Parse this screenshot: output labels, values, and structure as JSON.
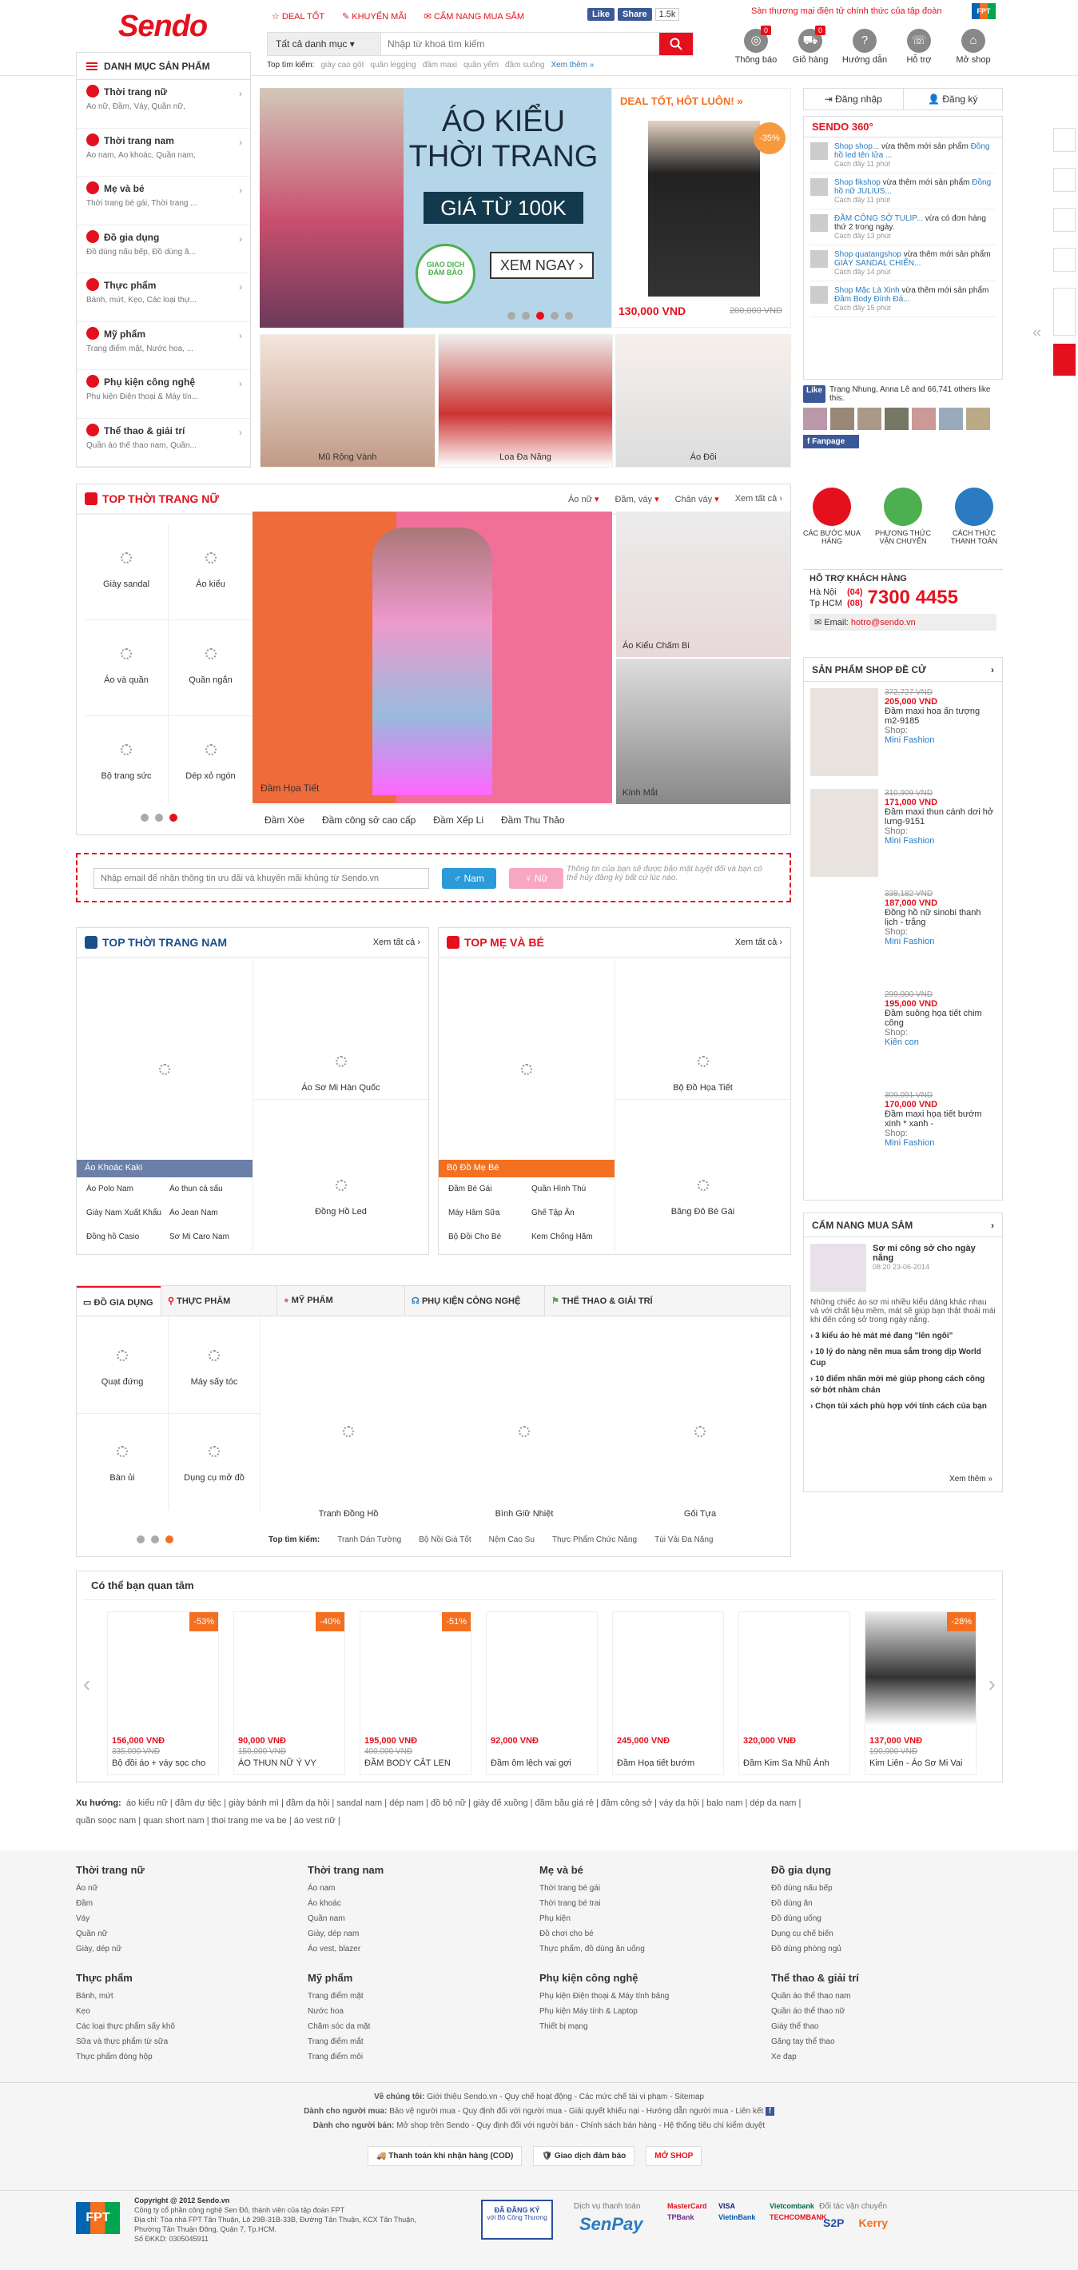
{
  "header": {
    "logo": "Sendo",
    "toplinks": [
      "DEAL TỐT",
      "KHUYẾN MÃI",
      "CẨM NANG MUA SẮM"
    ],
    "fb_like": "Like",
    "fb_share": "Share",
    "fb_count": "1.5k",
    "promo": "Sàn thương mại điện tử chính thức của tập đoàn",
    "fpt": "FPT",
    "search_category": "Tất cả danh mục",
    "search_placeholder": "Nhập từ khoá tìm kiếm",
    "top_search_label": "Top tìm kiếm:",
    "top_search": [
      "giày cao gót",
      "quần legging",
      "đầm maxi",
      "quần yếm",
      "đầm suông"
    ],
    "top_search_more": "Xem thêm »",
    "icons": [
      {
        "label": "Thông báo",
        "badge": "0",
        "icon": "globe-icon"
      },
      {
        "label": "Giỏ hàng",
        "badge": "0",
        "icon": "cart-icon"
      },
      {
        "label": "Hướng dẫn",
        "badge": "",
        "icon": "guide-icon"
      },
      {
        "label": "Hỗ trợ",
        "badge": "",
        "icon": "support-icon"
      },
      {
        "label": "Mở shop",
        "badge": "",
        "icon": "shop-icon"
      }
    ]
  },
  "sidebar": {
    "title": "DANH MỤC SẢN PHẨM",
    "items": [
      {
        "label": "Thời trang nữ",
        "sub": "Áo nữ, Đầm, Váy, Quần nữ,"
      },
      {
        "label": "Thời trang nam",
        "sub": "Áo nam, Áo khoác, Quần nam,"
      },
      {
        "label": "Mẹ và bé",
        "sub": "Thời trang bé gái, Thời trang ..."
      },
      {
        "label": "Đồ gia dụng",
        "sub": "Đồ dùng nấu bếp, Đồ dùng ă..."
      },
      {
        "label": "Thực phẩm",
        "sub": "Bánh, mứt, Kẹo, Các loại thự..."
      },
      {
        "label": "Mỹ phẩm",
        "sub": "Trang điểm mặt, Nước hoa, ..."
      },
      {
        "label": "Phụ kiện công nghệ",
        "sub": "Phụ kiện Điện thoại & Máy tín..."
      },
      {
        "label": "Thể thao & giải trí",
        "sub": "Quần áo thể thao nam, Quần..."
      }
    ]
  },
  "hero": {
    "title_line1": "ÁO KIỂU",
    "title_line2": "THỜI TRANG",
    "price": "GIÁ TỪ 100K",
    "cta": "XEM NGAY",
    "seal": "GIAO DỊCH ĐẢM BẢO",
    "active_slide": 4
  },
  "deal": {
    "title": "DEAL TỐT, HÔT LUÔN!",
    "discount": "-35%",
    "price": "130,000 VND",
    "old_price": "200,000 VND"
  },
  "thumbs": [
    "Mũ Rộng Vành",
    "Loa Đa Năng",
    "Áo Đôi"
  ],
  "account": {
    "login": "Đăng nhập",
    "register": "Đăng ký"
  },
  "sendo360": {
    "title": "SENDO 360°",
    "feed": [
      {
        "shop": "Shop shop...",
        "text": "vừa thêm mới sản phẩm",
        "product": "Đồng hồ led tên lửa ...",
        "time": "Cách đây 11 phút"
      },
      {
        "shop": "Shop fikshop",
        "text": "vừa thêm mới sản phẩm",
        "product": "Đồng hồ nữ JULIUS...",
        "time": "Cách đây 11 phút"
      },
      {
        "shop": "ĐẦM CÔNG SỞ TULIP...",
        "text": "vừa có đơn hàng thứ 2 trong ngày.",
        "product": "",
        "time": "Cách đây 13 phút"
      },
      {
        "shop": "Shop quatangshop",
        "text": "vừa thêm mới sản phẩm",
        "product": "GIÀY SANDAL CHIẾN...",
        "time": "Cách đây 14 phút"
      },
      {
        "shop": "Shop Mặc Là Xinh",
        "text": "vừa thêm mới sản phẩm",
        "product": "Đầm Body Đính Đá...",
        "time": "Cách đây 15 phút"
      }
    ],
    "fb_text": "Trang Nhung, Anna Lê and 66,741 others like this.",
    "fanpage": "Fanpage"
  },
  "women": {
    "title": "TOP THỜI TRANG NỮ",
    "tabs": [
      "Áo nữ",
      "Đầm, váy",
      "Chân váy",
      "Xem tất cả"
    ],
    "cells": [
      "Giày sandal",
      "Áo kiểu",
      "Áo và quần",
      "Quần ngắn",
      "Bộ trang sức",
      "Dép xỏ ngón"
    ],
    "banner": "Đầm Họa Tiết",
    "side1": "Áo Kiểu Chấm Bi",
    "side2": "Kính Mắt",
    "links": [
      "Đầm Xòe",
      "Đầm công sở cao cấp",
      "Đầm Xếp Li",
      "Đầm Thu Thảo"
    ]
  },
  "steps": [
    {
      "label": "CÁC BƯỚC MUA HÀNG",
      "color": "#e5101d"
    },
    {
      "label": "PHƯƠNG THỨC VẬN CHUYỂN",
      "color": "#4caf50"
    },
    {
      "label": "CÁCH THỨC THANH TOÁN",
      "color": "#2a7bc1"
    }
  ],
  "hotline": {
    "title": "HỖ TRỢ KHÁCH HÀNG",
    "hn": "Hà Nội",
    "hcm": "Tp HCM",
    "code1": "(04)",
    "code2": "(08)",
    "number": "7300 4455",
    "email_label": "Email:",
    "email": "hotro@sendo.vn"
  },
  "newsletter": {
    "placeholder": "Nhập email để nhận thông tin ưu đãi và khuyến mãi khủng từ Sendo.vn",
    "male": "Nam",
    "female": "Nữ",
    "note": "Thông tin của bạn sẽ được bảo mật tuyệt đối và bạn có thể hủy đăng ký bất cứ lúc nào."
  },
  "shop_recs": {
    "title": "SẢN PHẨM SHOP ĐỀ CỬ",
    "items": [
      {
        "old": "372,727 VND",
        "new": "205,000 VND",
        "name": "Đầm maxi hoa ấn tượng m2-9185",
        "shop": "Mini Fashion"
      },
      {
        "old": "310,909 VND",
        "new": "171,000 VND",
        "name": "Đầm maxi thun cánh dơi hở lưng-9151",
        "shop": "Mini Fashion"
      },
      {
        "old": "338,182 VND",
        "new": "187,000 VND",
        "name": "Đồng hồ nữ sinobi thanh lịch - trắng",
        "shop": "Mini Fashion"
      },
      {
        "old": "299,000 VND",
        "new": "195,000 VND",
        "name": "Đầm suông họa tiết chim công",
        "shop": "Kiến con"
      },
      {
        "old": "309,091 VND",
        "new": "170,000 VND",
        "name": "Đầm maxi họa tiết bướm xinh * xanh -",
        "shop": "Mini Fashion"
      }
    ],
    "shop_label": "Shop:"
  },
  "men": {
    "title": "TOP THỜI TRANG NAM",
    "all": "Xem tất cả",
    "cells": [
      "Áo Sơ Mi Hàn Quốc",
      "Đồng Hồ Led"
    ],
    "highlight": "Áo Khoác Kaki",
    "links": [
      "Áo Polo Nam",
      "Áo thun cá sấu",
      "Giày Nam Xuất Khẩu",
      "Áo Jean Nam",
      "Đồng hồ Casio",
      "Sơ Mi Caro Nam"
    ]
  },
  "baby": {
    "title": "TOP MẸ VÀ BÉ",
    "all": "Xem tất cả",
    "cells": [
      "Bộ Đồ Họa Tiết",
      "Băng Đô Bé Gái"
    ],
    "highlight": "Bộ Đồ Mẹ Bé",
    "links": [
      "Đầm Bé Gái",
      "Quần Hình Thú",
      "Máy Hâm Sữa",
      "Ghế Tập Ăn",
      "Bộ Đồi Cho Bé",
      "Kem Chống Hăm"
    ]
  },
  "guide": {
    "title": "CẨM NANG MUA SẮM",
    "feature": "Sơ mi công sở cho ngày nắng",
    "date": "08:20 23-06-2014",
    "desc": "Những chiếc áo sơ mi nhiều kiểu dáng khác nhau và với chất liệu mềm, mát sẽ giúp bạn thật thoải mái khi đến công sở trong ngày nắng.",
    "items": [
      "3 kiểu áo hè mát mẻ đang \"lên ngôi\"",
      "10 lý do nàng nên mua sắm trong dịp World Cup",
      "10 điểm nhấn mới mẻ giúp phong cách công sở bớt nhàm chán",
      "Chọn túi xách phù hợp với tính cách của bạn"
    ],
    "more": "Xem thêm"
  },
  "home": {
    "tabs": [
      "ĐỒ GIA DỤNG",
      "THỰC PHẨM",
      "MỸ PHẨM",
      "PHỤ KIỆN CÔNG NGHỆ",
      "THỂ THAO & GIẢI TRÍ"
    ],
    "cells": [
      "Quạt đứng",
      "Máy sấy tóc",
      "Bàn ủi",
      "Dụng cụ mở đồ"
    ],
    "products": [
      "Tranh Đồng Hồ",
      "Bình Giữ Nhiệt",
      "Gối Tựa"
    ],
    "search_label": "Top tìm kiếm:",
    "search": [
      "Tranh Dán Tường",
      "Bộ Nồi Giá Tốt",
      "Nệm Cao Su",
      "Thực Phẩm Chức Năng",
      "Túi Vải Đa Năng"
    ]
  },
  "recommended": {
    "title": "Có thể bạn quan tâm",
    "items": [
      {
        "disc": "-53%",
        "price": "156,000 VNĐ",
        "old": "335,000 VNĐ",
        "name": "Bộ đồi áo + váy sọc cho"
      },
      {
        "disc": "-40%",
        "price": "90,000 VNĐ",
        "old": "150,000 VNĐ",
        "name": "ÁO THUN NỮ Ý VY"
      },
      {
        "disc": "-51%",
        "price": "195,000 VNĐ",
        "old": "400,000 VNĐ",
        "name": "ĐẦM BODY CẮT LEN"
      },
      {
        "disc": "",
        "price": "92,000 VNĐ",
        "old": "",
        "name": "Đầm ôm lệch vai gợi"
      },
      {
        "disc": "",
        "price": "245,000 VNĐ",
        "old": "",
        "name": "Đầm Họa tiết bướm"
      },
      {
        "disc": "",
        "price": "320,000 VNĐ",
        "old": "",
        "name": "Đầm Kim Sa Nhũ Ánh"
      },
      {
        "disc": "-28%",
        "price": "137,000 VNĐ",
        "old": "190,000 VNĐ",
        "name": "Kim Liên - Áo Sơ Mi Vai"
      }
    ]
  },
  "trends": {
    "label": "Xu hướng:",
    "line1": [
      "áo kiểu nữ",
      "đầm dự tiệc",
      "giày bánh mì",
      "đầm dạ hội",
      "sandal nam",
      "dép nam",
      "đồ bộ nữ",
      "giày đế xuồng",
      "đầm bầu giá rẻ",
      "đầm công sở",
      "váy dạ hội",
      "balo nam",
      "dép da nam"
    ],
    "line2": [
      "quần soọc nam",
      "quan short nam",
      "thoi trang me va be",
      "áo vest nữ"
    ]
  },
  "footer": {
    "cols": [
      {
        "title": "Thời trang nữ",
        "items": [
          "Áo nữ",
          "Đầm",
          "Váy",
          "Quần nữ",
          "Giày, dép nữ"
        ]
      },
      {
        "title": "Thời trang nam",
        "items": [
          "Áo nam",
          "Áo khoác",
          "Quần nam",
          "Giày, dép nam",
          "Áo vest, blazer"
        ]
      },
      {
        "title": "Mẹ và bé",
        "items": [
          "Thời trang bé gái",
          "Thời trang bé trai",
          "Phụ kiện",
          "Đồ chơi cho bé",
          "Thực phẩm, đồ dùng ăn uống"
        ]
      },
      {
        "title": "Đồ gia dụng",
        "items": [
          "Đồ dùng nấu bếp",
          "Đồ dùng ăn",
          "Đồ dùng uống",
          "Dụng cụ chế biến",
          "Đồ dùng phòng ngủ"
        ]
      },
      {
        "title": "Thực phẩm",
        "items": [
          "Bánh, mứt",
          "Kẹo",
          "Các loại thực phẩm sấy khô",
          "Sữa và thực phẩm từ sữa",
          "Thực phẩm đóng hộp"
        ]
      },
      {
        "title": "Mỹ phẩm",
        "items": [
          "Trang điểm mặt",
          "Nước hoa",
          "Chăm sóc da mặt",
          "Trang điểm mắt",
          "Trang điểm môi"
        ]
      },
      {
        "title": "Phụ kiện công nghệ",
        "items": [
          "Phụ kiện Điện thoại & Máy tính bảng",
          "Phụ kiện Máy tính & Laptop",
          "Thiết bị mạng"
        ]
      },
      {
        "title": "Thể thao & giải trí",
        "items": [
          "Quần áo thể thao nam",
          "Quần áo thể thao nữ",
          "Giày thể thao",
          "Găng tay thể thao",
          "Xe đạp"
        ]
      }
    ],
    "about_label": "Về chúng tôi:",
    "about": "Giới thiệu Sendo.vn  -  Quy chế hoạt động  -  Các mức chế tài vi phạm  -  Sitemap",
    "buyer_label": "Dành cho người mua:",
    "buyer": "Bảo vệ người mua  -  Quy định đối với người mua  -  Giải quyết khiếu nại  -  Hướng dẫn người mua  -  Liên kết",
    "seller_label": "Dành cho người bán:",
    "seller": "Mở shop trên Sendo  -  Quy định đối với người bán  -  Chính sách bán hàng  -  Hệ thống tiêu chí kiểm duyệt",
    "badges": [
      "Thanh toán khi nhận hàng (COD)",
      "Giao dịch đảm bảo",
      "MỞ SHOP"
    ],
    "copyright": "Copyright @ 2012 Sendo.vn",
    "company": "Công ty cổ phần công nghệ Sen Đỏ, thành viên của tập đoàn FPT",
    "address": "Địa chỉ: Tòa nhà FPT Tân Thuận, Lô 29B-31B-33B, Đường Tân Thuận, KCX Tân Thuận, Phường Tân Thuận Đông, Quận 7, Tp.HCM.",
    "ekkd": "Số ĐKKD: 0305045911",
    "registered": "ĐÃ ĐĂNG KÝ",
    "registered_sub": "với Bộ Công Thương",
    "payment_label": "Dịch vụ thanh toán",
    "payment": "SenPay",
    "shipping_label": "Đối tác vận chuyển",
    "banks": [
      "MasterCard",
      "VISA",
      "Vietcombank",
      "TPBank",
      "VietinBank",
      "TECHCOMBANK"
    ],
    "carriers": [
      "S2P",
      "Kerry"
    ]
  }
}
